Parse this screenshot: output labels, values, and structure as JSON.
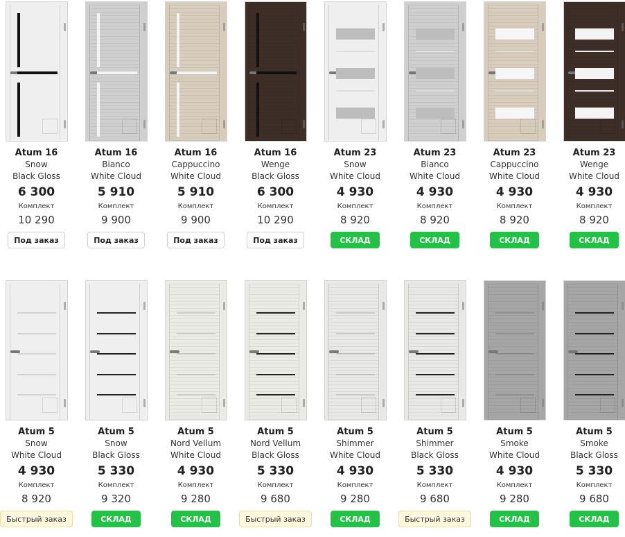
{
  "colors": {
    "snow": "#efefef",
    "bianco": "#cfcfcf",
    "cappuccino": "#d8ccbd",
    "wenge": "#3d2f27",
    "nord": "#ebebe6",
    "shimmer": "#e8e8e6",
    "smoke": "#a6a6a6",
    "stock_green": "#22c247"
  },
  "products": [
    {
      "name": "Atum 16",
      "color": "Snow",
      "glass": "Black Gloss",
      "price": "6 300",
      "kit_label": "Комплект",
      "kit_price": "10 290",
      "button": "Под заказ",
      "btn": "order",
      "model": "16",
      "tone": "snow"
    },
    {
      "name": "Atum 16",
      "color": "Bianco",
      "glass": "White Cloud",
      "price": "5 910",
      "kit_label": "Комплект",
      "kit_price": "9 900",
      "button": "Под заказ",
      "btn": "order",
      "model": "16",
      "tone": "bianco"
    },
    {
      "name": "Atum 16",
      "color": "Cappuccino",
      "glass": "White Cloud",
      "price": "5 910",
      "kit_label": "Комплект",
      "kit_price": "9 900",
      "button": "Под заказ",
      "btn": "order",
      "model": "16",
      "tone": "cappuccino"
    },
    {
      "name": "Atum 16",
      "color": "Wenge",
      "glass": "Black Gloss",
      "price": "6 300",
      "kit_label": "Комплект",
      "kit_price": "10 290",
      "button": "Под заказ",
      "btn": "order",
      "model": "16",
      "tone": "wenge"
    },
    {
      "name": "Atum 23",
      "color": "Snow",
      "glass": "White Cloud",
      "price": "4 930",
      "kit_label": "Комплект",
      "kit_price": "8 920",
      "button": "СКЛАД",
      "btn": "stock",
      "model": "23",
      "tone": "snow"
    },
    {
      "name": "Atum 23",
      "color": "Bianco",
      "glass": "White Cloud",
      "price": "4 930",
      "kit_label": "Комплект",
      "kit_price": "8 920",
      "button": "СКЛАД",
      "btn": "stock",
      "model": "23",
      "tone": "bianco"
    },
    {
      "name": "Atum 23",
      "color": "Cappuccino",
      "glass": "White Cloud",
      "price": "4 930",
      "kit_label": "Комплект",
      "kit_price": "8 920",
      "button": "СКЛАД",
      "btn": "stock",
      "model": "23",
      "tone": "cappuccino"
    },
    {
      "name": "Atum 23",
      "color": "Wenge",
      "glass": "White Cloud",
      "price": "4 930",
      "kit_label": "Комплект",
      "kit_price": "8 920",
      "button": "СКЛАД",
      "btn": "stock",
      "model": "23",
      "tone": "wenge"
    },
    {
      "name": "Atum 5",
      "color": "Snow",
      "glass": "White Cloud",
      "price": "4 930",
      "kit_label": "Комплект",
      "kit_price": "8 920",
      "button": "Быстрый заказ",
      "btn": "quick",
      "model": "5w",
      "tone": "snow"
    },
    {
      "name": "Atum 5",
      "color": "Snow",
      "glass": "Black Gloss",
      "price": "5 330",
      "kit_label": "Комплект",
      "kit_price": "9 320",
      "button": "СКЛАД",
      "btn": "stock",
      "model": "5b",
      "tone": "snow"
    },
    {
      "name": "Atum 5",
      "color": "Nord Vellum",
      "glass": "White Cloud",
      "price": "4 930",
      "kit_label": "Комплект",
      "kit_price": "9 280",
      "button": "СКЛАД",
      "btn": "stock",
      "model": "5w",
      "tone": "nord"
    },
    {
      "name": "Atum 5",
      "color": "Nord Vellum",
      "glass": "Black Gloss",
      "price": "5 330",
      "kit_label": "Комплект",
      "kit_price": "9 680",
      "button": "Быстрый заказ",
      "btn": "quick",
      "model": "5b",
      "tone": "nord"
    },
    {
      "name": "Atum 5",
      "color": "Shimmer",
      "glass": "White Cloud",
      "price": "4 930",
      "kit_label": "Комплект",
      "kit_price": "9 280",
      "button": "СКЛАД",
      "btn": "stock",
      "model": "5w",
      "tone": "shimmer"
    },
    {
      "name": "Atum 5",
      "color": "Shimmer",
      "glass": "Black Gloss",
      "price": "5 330",
      "kit_label": "Комплект",
      "kit_price": "9 680",
      "button": "Быстрый заказ",
      "btn": "quick",
      "model": "5b",
      "tone": "shimmer"
    },
    {
      "name": "Atum 5",
      "color": "Smoke",
      "glass": "White Cloud",
      "price": "4 930",
      "kit_label": "Комплект",
      "kit_price": "9 280",
      "button": "СКЛАД",
      "btn": "stock",
      "model": "5w",
      "tone": "smoke"
    },
    {
      "name": "Atum 5",
      "color": "Smoke",
      "glass": "Black Gloss",
      "price": "5 330",
      "kit_label": "Комплект",
      "kit_price": "9 680",
      "button": "СКЛАД",
      "btn": "stock",
      "model": "5b",
      "tone": "smoke"
    }
  ]
}
